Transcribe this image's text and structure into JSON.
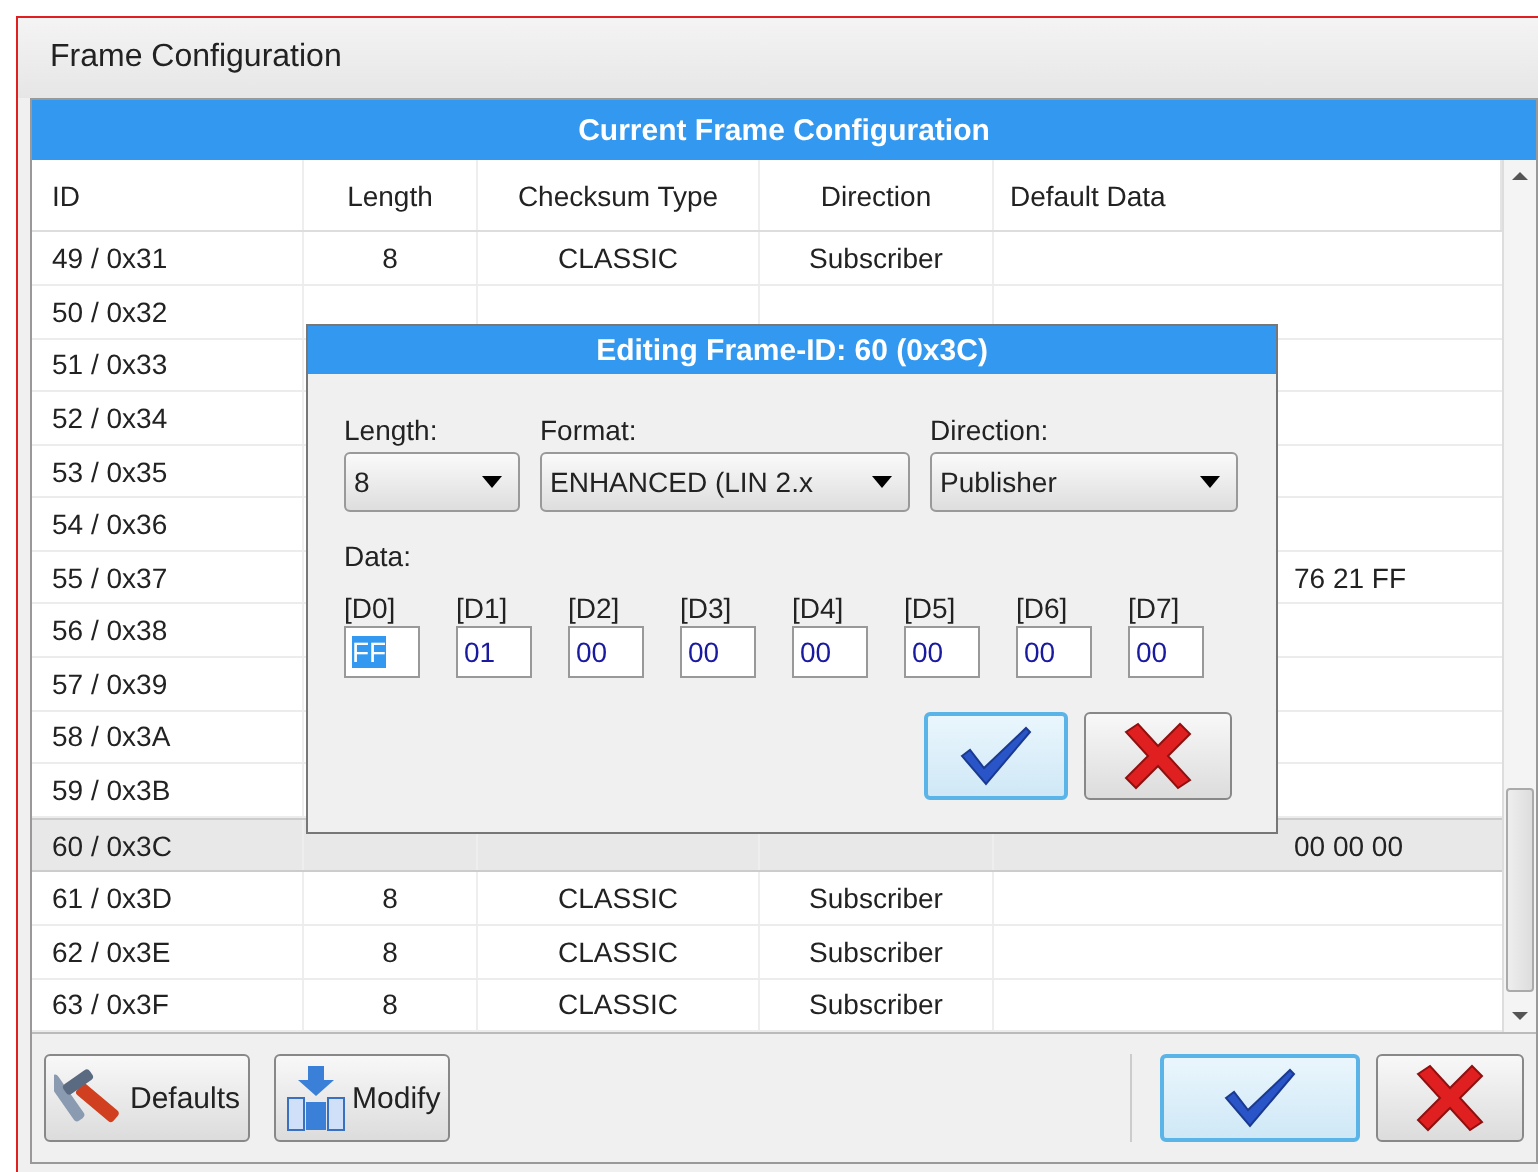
{
  "window": {
    "title": "Frame Configuration"
  },
  "table": {
    "title": "Current Frame Configuration",
    "columns": [
      "ID",
      "Length",
      "Checksum Type",
      "Direction",
      "Default Data"
    ],
    "rows": [
      {
        "id": "49 / 0x31",
        "length": "8",
        "checksum": "CLASSIC",
        "direction": "Subscriber",
        "selected": false
      },
      {
        "id": "50 / 0x32",
        "selected": false
      },
      {
        "id": "51 / 0x33",
        "selected": false
      },
      {
        "id": "52 / 0x34",
        "selected": false
      },
      {
        "id": "53 / 0x35",
        "selected": false
      },
      {
        "id": "54 / 0x36",
        "selected": false
      },
      {
        "id": "55 / 0x37",
        "data": "76 21 FF",
        "selected": false
      },
      {
        "id": "56 / 0x38",
        "selected": false
      },
      {
        "id": "57 / 0x39",
        "selected": false
      },
      {
        "id": "58 / 0x3A",
        "selected": false
      },
      {
        "id": "59 / 0x3B",
        "selected": false
      },
      {
        "id": "60 / 0x3C",
        "data": "00 00 00",
        "selected": true
      },
      {
        "id": "61 / 0x3D",
        "length": "8",
        "checksum": "CLASSIC",
        "direction": "Subscriber",
        "selected": false
      },
      {
        "id": "62 / 0x3E",
        "length": "8",
        "checksum": "CLASSIC",
        "direction": "Subscriber",
        "selected": false
      },
      {
        "id": "63 / 0x3F",
        "length": "8",
        "checksum": "CLASSIC",
        "direction": "Subscriber",
        "selected": false
      }
    ]
  },
  "dialog": {
    "title": "Editing Frame-ID: 60 (0x3C)",
    "fields": [
      {
        "label": "Length:",
        "value": "8"
      },
      {
        "label": "Format:",
        "value": "ENHANCED (LIN 2.x"
      },
      {
        "label": "Direction:",
        "value": "Publisher"
      }
    ],
    "data_label": "Data:",
    "bytes": [
      {
        "label": "[D0]",
        "value": "FF",
        "selected": true
      },
      {
        "label": "[D1]",
        "value": "01",
        "selected": false
      },
      {
        "label": "[D2]",
        "value": "00",
        "selected": false
      },
      {
        "label": "[D3]",
        "value": "00",
        "selected": false
      },
      {
        "label": "[D4]",
        "value": "00",
        "selected": false
      },
      {
        "label": "[D5]",
        "value": "00",
        "selected": false
      },
      {
        "label": "[D6]",
        "value": "00",
        "selected": false
      },
      {
        "label": "[D7]",
        "value": "00",
        "selected": false
      }
    ],
    "buttons": [
      {
        "kind": "ok",
        "focused": true
      },
      {
        "kind": "cancel",
        "focused": false
      }
    ]
  },
  "buttons": [
    {
      "kind": "defaults",
      "label": "Defaults"
    },
    {
      "kind": "modify",
      "label": "Modify"
    },
    {
      "kind": "ok",
      "focused": true
    },
    {
      "kind": "cancel",
      "focused": false
    }
  ]
}
